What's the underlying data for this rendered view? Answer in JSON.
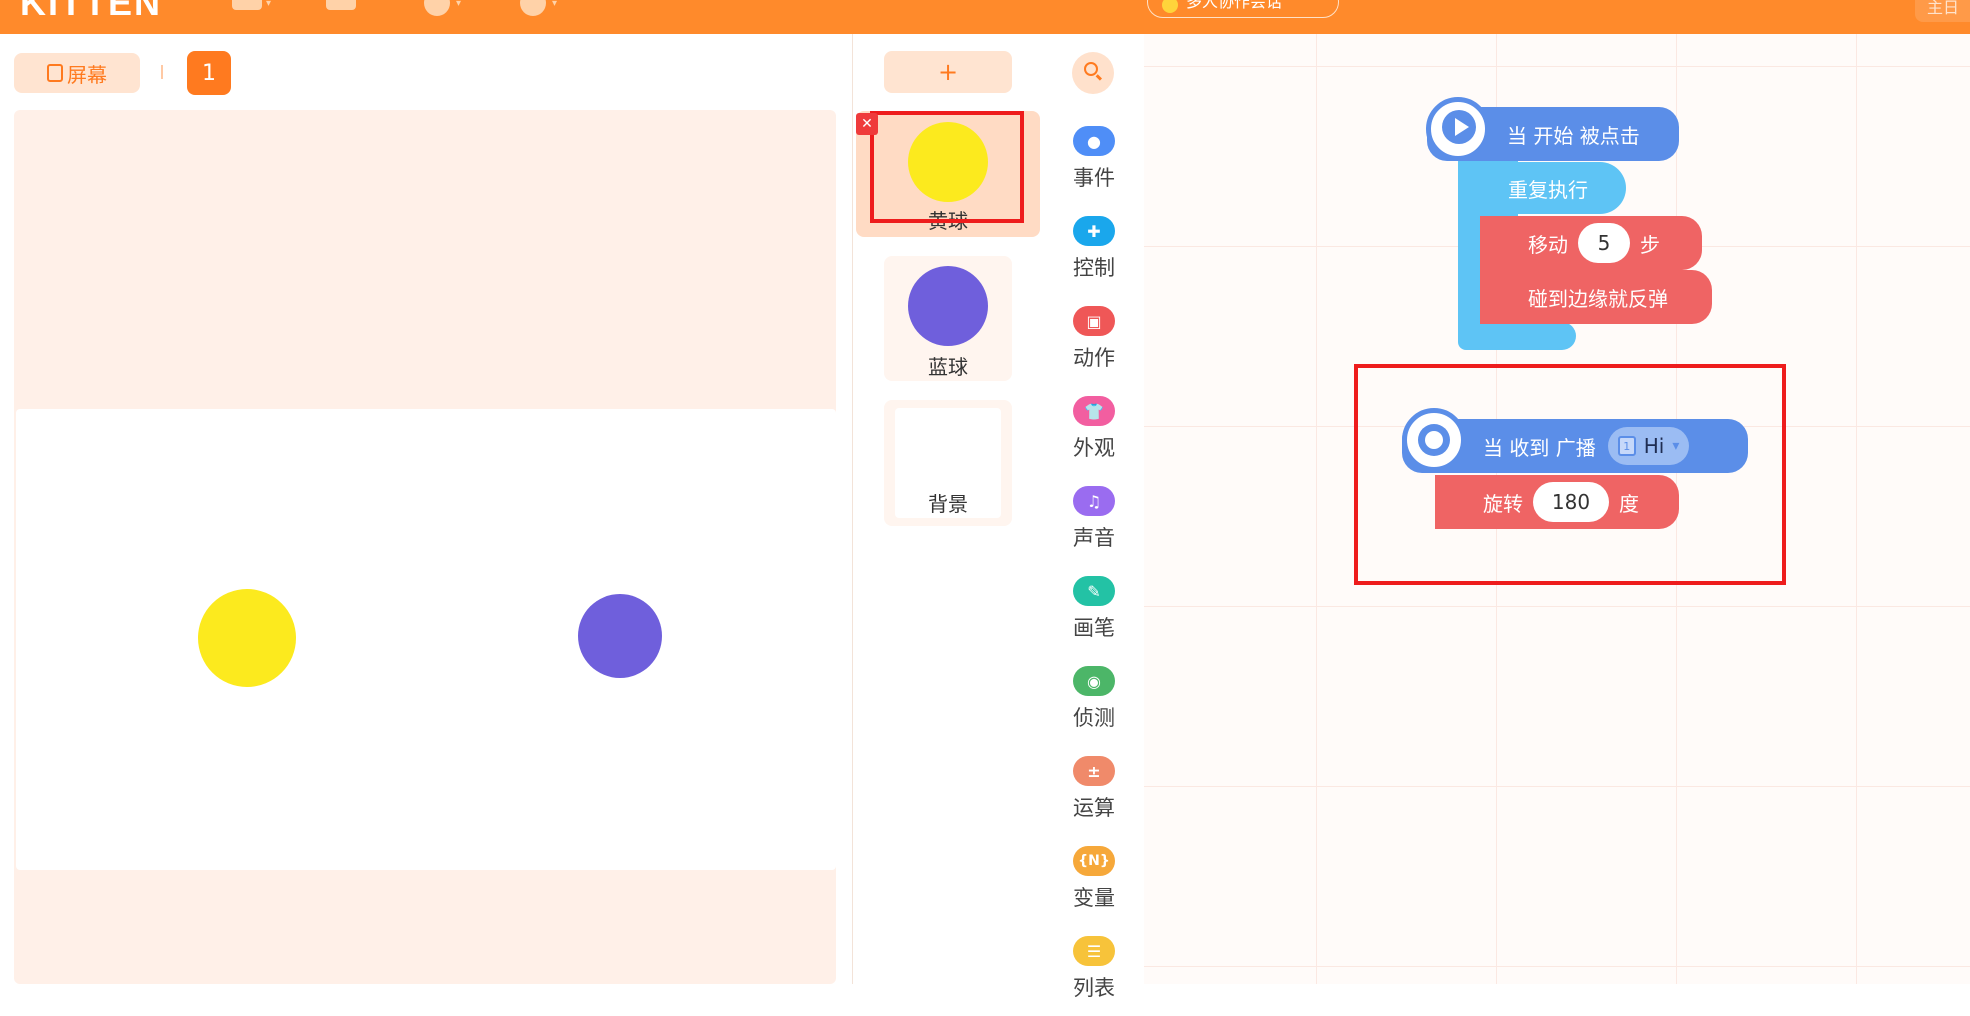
{
  "topbar": {
    "logo": "KITTEN",
    "collab_label": "多人协作会话",
    "user_label": "主日"
  },
  "stage": {
    "screen_label": "屏幕",
    "page_number": "1"
  },
  "sprites": {
    "add_label": "+",
    "items": [
      {
        "name": "黄球",
        "color": "#fcea1e",
        "selected": true
      },
      {
        "name": "蓝球",
        "color": "#6f5fdc",
        "selected": false
      },
      {
        "name": "背景",
        "color": "#ffffff",
        "selected": false
      }
    ]
  },
  "categories": [
    {
      "label": "事件",
      "icon": "event-icon",
      "color": "#4f8ef7"
    },
    {
      "label": "控制",
      "icon": "control-icon",
      "color": "#1aa7ec"
    },
    {
      "label": "动作",
      "icon": "motion-icon",
      "color": "#ef5757"
    },
    {
      "label": "外观",
      "icon": "looks-icon",
      "color": "#f25ea0"
    },
    {
      "label": "声音",
      "icon": "sound-icon",
      "color": "#9a6cf0"
    },
    {
      "label": "画笔",
      "icon": "pen-icon",
      "color": "#23c2a5"
    },
    {
      "label": "侦测",
      "icon": "sensing-icon",
      "color": "#4cb668"
    },
    {
      "label": "运算",
      "icon": "operator-icon",
      "color": "#f08a6a"
    },
    {
      "label": "变量",
      "icon": "variable-icon",
      "color": "#f6a83a",
      "glyph": "{N}"
    },
    {
      "label": "列表",
      "icon": "list-icon",
      "color": "#f7c33a"
    }
  ],
  "code": {
    "script1": {
      "hat": "当 开始 被点击",
      "repeat": "重复执行",
      "move_prefix": "移动",
      "move_value": "5",
      "move_suffix": "步",
      "bounce": "碰到边缘就反弹"
    },
    "script2": {
      "hat_prefix": "当 收到 广播",
      "broadcast_value": "Hi",
      "turn_prefix": "旋转",
      "turn_value": "180",
      "turn_suffix": "度"
    }
  }
}
